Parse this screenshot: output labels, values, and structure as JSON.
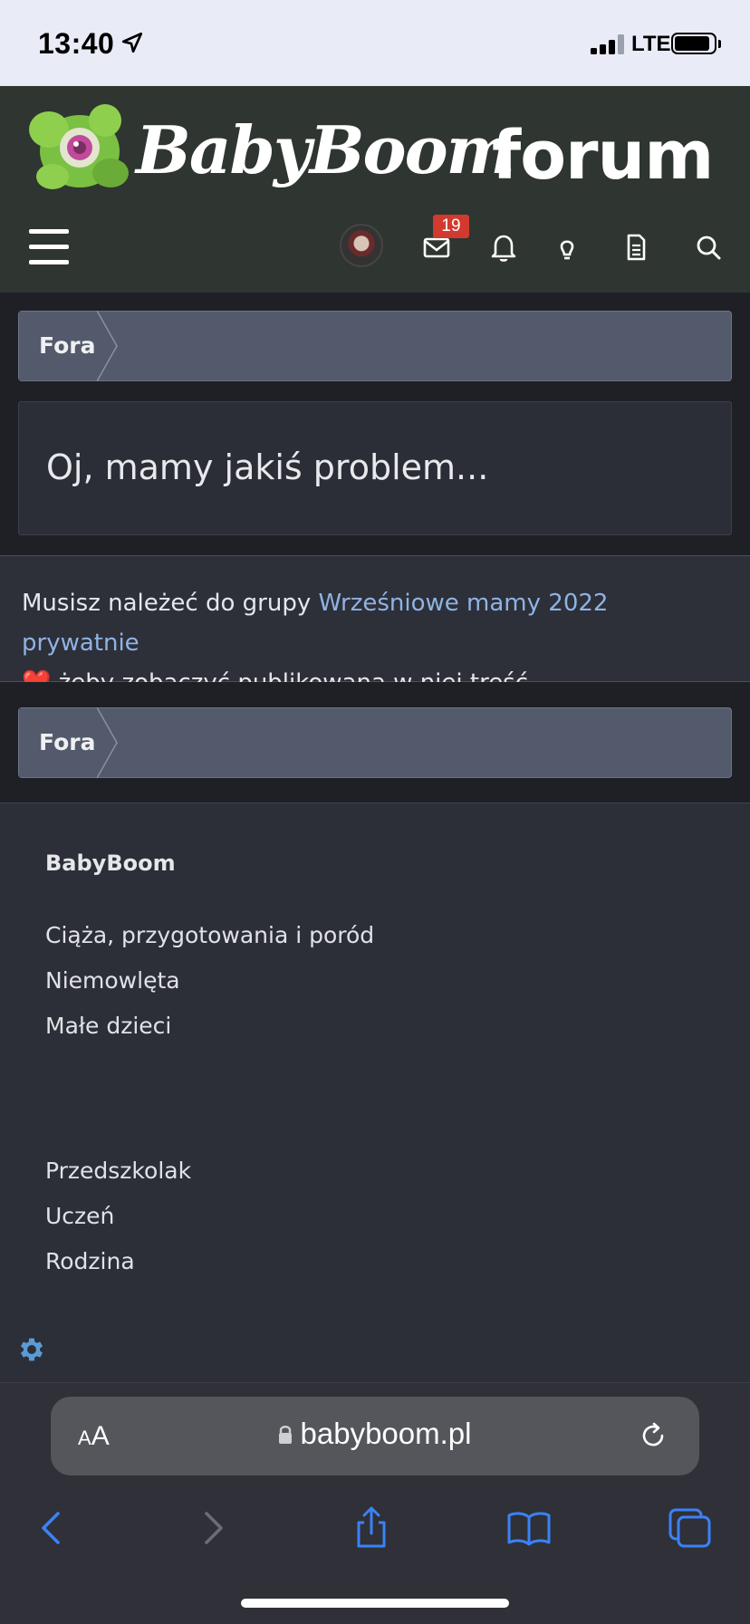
{
  "status_bar": {
    "time": "13:40",
    "network": "LTE"
  },
  "header": {
    "logo_text": "BabyBoom",
    "logo_tm": "™",
    "forum_text": "forum",
    "notification_count": "19"
  },
  "breadcrumb_top": {
    "label": "Fora"
  },
  "page_title": "Oj, mamy jakiś problem...",
  "notice": {
    "before": "Musisz należeć do grupy ",
    "link": "Wrześniowe mamy 2022 prywatnie",
    "heart": "❤️",
    "after": " żeby zobaczyć publikowaną w niej treść."
  },
  "breadcrumb_bottom": {
    "label": "Fora"
  },
  "footer": {
    "title": "BabyBoom",
    "links": [
      "Ciąża, przygotowania i poród",
      "Niemowlęta",
      "Małe dzieci",
      "Przedszkolak",
      "Uczeń",
      "Rodzina"
    ]
  },
  "browser": {
    "text_size_small": "A",
    "text_size_big": "A",
    "url": "babyboom.pl"
  },
  "colors": {
    "accent_link": "#8fb3e3",
    "badge": "#d23a2f",
    "toolbar_blue": "#3b82f6"
  }
}
